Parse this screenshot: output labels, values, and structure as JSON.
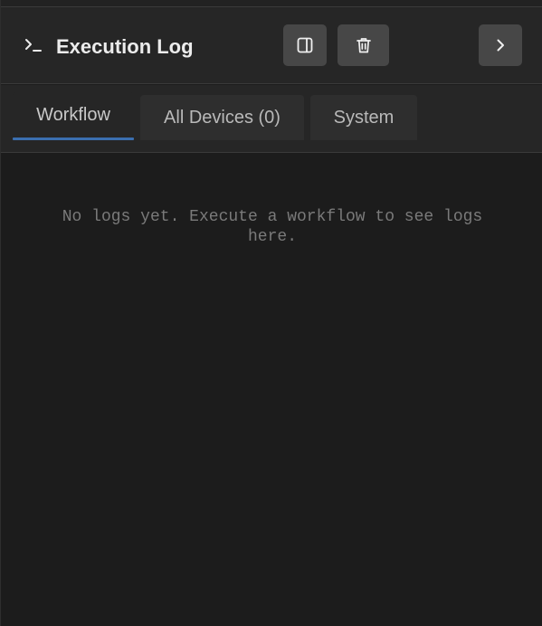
{
  "header": {
    "title": "Execution Log",
    "title_icon": "terminal-icon",
    "buttons": {
      "toggle_panel_icon": "sidebar-toggle-icon",
      "clear_icon": "trash-icon",
      "collapse_icon": "chevron-right-icon"
    }
  },
  "tabs": [
    {
      "label": "Workflow",
      "active": true
    },
    {
      "label": "All Devices (0)",
      "active": false
    },
    {
      "label": "System",
      "active": false
    }
  ],
  "log": {
    "empty_message": "No logs yet. Execute a workflow to see logs here."
  },
  "colors": {
    "background": "#1c1c1c",
    "header_bg": "#262626",
    "button_bg": "#474747",
    "active_tab_accent": "#3b6fb0",
    "muted_text": "#7a7a7a"
  }
}
